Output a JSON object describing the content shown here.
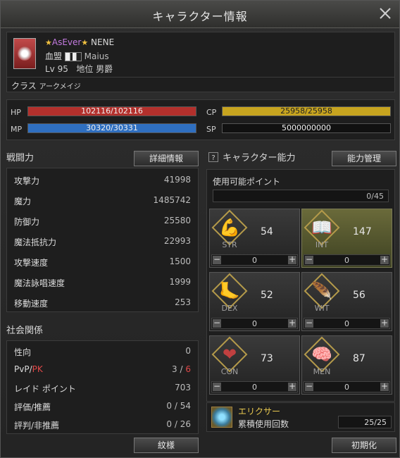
{
  "window": {
    "title": "キャラクター情報"
  },
  "profile": {
    "pledge_name": "AsEver",
    "char_name": "NENE",
    "alliance": "血盟",
    "clan_name": "Maius",
    "level": "Lv 95",
    "rank_label": "地位",
    "rank": "男爵",
    "class_label": "クラス",
    "class_value": "アークメイジ"
  },
  "bars": {
    "hp": {
      "label": "HP",
      "text": "102116/102116",
      "fill": 1.0,
      "color": "#b3302c"
    },
    "mp": {
      "label": "MP",
      "text": "30320/30331",
      "fill": 0.9996,
      "color": "#2f6fc0"
    },
    "cp": {
      "label": "CP",
      "text": "25958/25958",
      "fill": 1.0,
      "color": "#c7a41f"
    },
    "sp": {
      "label": "SP",
      "text": "5000000000"
    }
  },
  "combat": {
    "title": "戦闘力",
    "detail_button": "詳細情報",
    "rows": [
      {
        "k": "攻撃力",
        "v": "41998"
      },
      {
        "k": "魔力",
        "v": "1485742"
      },
      {
        "k": "防御力",
        "v": "25580"
      },
      {
        "k": "魔法抵抗力",
        "v": "22993"
      },
      {
        "k": "攻撃速度",
        "v": "1500"
      },
      {
        "k": "魔法詠唱速度",
        "v": "1999"
      },
      {
        "k": "移動速度",
        "v": "253"
      }
    ]
  },
  "social": {
    "title": "社会関係",
    "karma_label": "性向",
    "karma_value": "0",
    "pvp_label": "PvP/",
    "pk_label": "PK",
    "pvp_value": "3",
    "slash": "/",
    "pk_value": "6",
    "raid_label": "レイド ポイント",
    "raid_value": "703",
    "rec_label": "評価/推薦",
    "rec_value": "0 / 54",
    "rep_label": "評判/非推薦",
    "rep_value": "0 / 26"
  },
  "ability": {
    "title": "キャラクター能力",
    "manage_button": "能力管理",
    "points_label": "使用可能ポイント",
    "points_value": "0/45",
    "stats": [
      {
        "abbr": "STR",
        "value": "54",
        "alloc": "0",
        "icon": "arm-icon",
        "glyph": "💪"
      },
      {
        "abbr": "INT",
        "value": "147",
        "alloc": "0",
        "icon": "book-icon",
        "glyph": "📖"
      },
      {
        "abbr": "DEX",
        "value": "52",
        "alloc": "0",
        "icon": "foot-icon",
        "glyph": "🦶"
      },
      {
        "abbr": "WIT",
        "value": "56",
        "alloc": "0",
        "icon": "feather-icon",
        "glyph": "🪶"
      },
      {
        "abbr": "CON",
        "value": "73",
        "alloc": "0",
        "icon": "heart-icon",
        "glyph": "❤"
      },
      {
        "abbr": "MEN",
        "value": "87",
        "alloc": "0",
        "icon": "brain-icon",
        "glyph": "🧠"
      }
    ],
    "elixir_label": "エリクサー",
    "elixir_sub": "累積使用回数",
    "elixir_value": "25/25"
  },
  "footer": {
    "crest_button": "紋様",
    "reset_button": "初期化"
  },
  "colors": {
    "stat_label": "#a0a0a0",
    "pk_red": "#e04848",
    "pledge_purple": "#c47be0"
  }
}
